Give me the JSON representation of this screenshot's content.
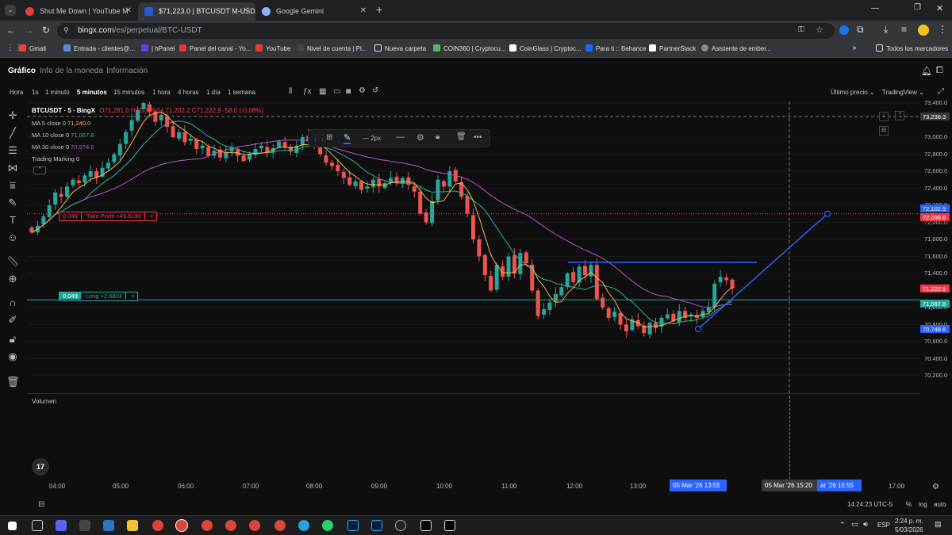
{
  "browser": {
    "tabs": [
      {
        "title": "Shut Me Down | YouTube M",
        "icon": "youtube-icon",
        "color": "#e53935"
      },
      {
        "title": "$71,223.0 | BTCUSDT M-USD⊙",
        "icon": "bingx-icon",
        "color": "#2a56d6"
      },
      {
        "title": "Google Gemini",
        "icon": "gemini-icon",
        "color": "#8ab4f8"
      }
    ],
    "url_host": "bingx.com",
    "url_path": "/es/perpetual/BTC-USDT",
    "bookmarks": [
      "Gmail",
      "Entrada - clientes@...",
      "| hPanel",
      "Panel del canal - Yo...",
      "YouTube",
      "Nivel de cuenta | Pl...",
      "Nueva carpeta",
      "COIN360 | Cryptocu...",
      "CoinGlass | Cryptoc...",
      "Para ti :: Behance",
      "PartnerStack",
      "Asistente de ember..."
    ],
    "all_bookmarks": "Todos los marcadores"
  },
  "app": {
    "tabs": [
      "Gráfico",
      "Info de la moneda",
      "Información"
    ],
    "timeframes": [
      "Hora",
      "1s",
      "1 minuto",
      "5 minutos",
      "15 minutos",
      "1 hora",
      "4 horas",
      "1 día",
      "1 semana"
    ],
    "active_timeframe": "5 minutos",
    "price_mode": "Último precio",
    "provider": "TradingView"
  },
  "legend": {
    "symbol": "BTCUSDT · 5 · BingX",
    "ohlc": "O71,281.0 H71,398.0 L71,202.2 C71,222.9 -58.0 (-0,08%)",
    "ma5_label": "MA 5 close 0",
    "ma5_value": "71,240.0",
    "ma10_label": "MA 10 close 0",
    "ma10_value": "71,067.8",
    "ma30_label": "MA 30 close 0",
    "ma30_value": "70,974.6",
    "trading_marking": "Trading Marking",
    "trading_marking_value": "0"
  },
  "drawing_toolbar": {
    "width_label": "2px"
  },
  "positions": {
    "tp_qty": "0.049",
    "tp_label": "Take Profit +45.6190",
    "tp_close": "×",
    "long_qty": "0.049",
    "long_label": "Long +2.6803",
    "long_close": "×"
  },
  "volume_label": "Volumen",
  "chart_data": {
    "type": "candlestick",
    "symbol": "BTCUSDT",
    "interval": "5 minutos",
    "price_ticks": [
      "73,400.0",
      "73,000.0",
      "72,800.0",
      "72,600.0",
      "72,400.0",
      "72,200.0",
      "72,000.0",
      "71,800.0",
      "71,600.0",
      "71,400.0",
      "71,000.0",
      "70,800.0",
      "70,600.0",
      "70,400.0",
      "70,200.0"
    ],
    "price_tick_values": [
      73400,
      73000,
      72800,
      72600,
      72400,
      72200,
      72000,
      71800,
      71600,
      71400,
      71000,
      70800,
      70600,
      70400,
      70200
    ],
    "ylim": [
      70100,
      73420
    ],
    "time_ticks": [
      "04:00",
      "05:00",
      "06:00",
      "07:00",
      "08:00",
      "09:00",
      "10:00",
      "11:00",
      "12:00",
      "13:00",
      "17:00"
    ],
    "price_tags": {
      "crosshair": "73,238.3",
      "tp_line": "72,102.5",
      "tp_line_2": "72,098.8",
      "last": "71,222.9",
      "ma": "71,067.8",
      "anchor": "70,748.6"
    },
    "tp_value": 72100,
    "long_value": 71090,
    "resistance_value": 71530,
    "trendline": {
      "from_time": "13:55",
      "from_price": 70748.6,
      "to_price": 72100
    },
    "time_labels": [
      "05 Mar '26   13:55",
      "05 Mar '26   15:20",
      "ar '26   15:55"
    ],
    "closes": [
      71880,
      71960,
      72070,
      72200,
      72350,
      72300,
      72420,
      72500,
      72460,
      72550,
      72600,
      72520,
      72640,
      72700,
      72800,
      72920,
      73060,
      73200,
      73320,
      73400,
      73300,
      73180,
      73260,
      73120,
      73000,
      73060,
      72940,
      72980,
      72860,
      72900,
      72780,
      72840,
      72760,
      72820,
      72880,
      72780,
      72720,
      72800,
      72860,
      72900,
      72820,
      72870,
      72950,
      72880,
      72830,
      72900,
      73000,
      72950,
      72880,
      72800,
      72700,
      72660,
      72600,
      72520,
      72440,
      72480,
      72380,
      72420,
      72500,
      72420,
      72460,
      72520,
      72460,
      72520,
      72440,
      72360,
      72100,
      72000,
      72250,
      72500,
      72420,
      72600,
      72480,
      72300,
      72100,
      71800,
      71600,
      71380,
      71200,
      71500,
      71360,
      71600,
      71400,
      71640,
      71520,
      71200,
      70900,
      70980,
      71060,
      71160,
      71240,
      71400,
      71300,
      71480,
      71380,
      71500,
      71100,
      71000,
      70880,
      70950,
      70800,
      70720,
      70860,
      70780,
      70700,
      70820,
      70760,
      70880,
      70920,
      70840,
      70960,
      70880,
      70920,
      70880,
      70960,
      71000,
      71280,
      71360,
      71320,
      71223
    ]
  },
  "status": {
    "time": "14:24:23 UTC-5",
    "pct": "%",
    "log": "log",
    "auto": "auto"
  },
  "taskbar": {
    "lang": "ESP",
    "clock": "2:24 p. m.",
    "date": "5/03/2026"
  }
}
